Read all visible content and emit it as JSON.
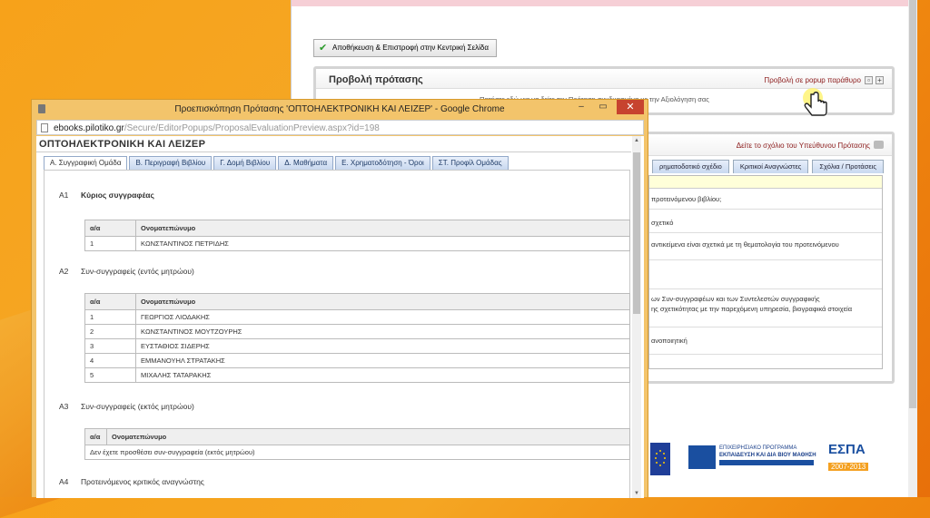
{
  "background_page": {
    "save_button": "Αποθήκευση & Επιστροφή στην Κεντρική Σελίδα",
    "panel_title": "Προβολή πρότασης",
    "popup_link": "Προβολή σε popup παράθυρο",
    "panel_text": "Πατήστε εδώ για να δείτε την Πρόταση συνδυασμένα με την Αξιολόγηση σας",
    "comment_link": "Δείτε το σχόλιο του Υπεύθυνου Πρότασης",
    "tabs": [
      "ρηματοδοτικό σχέδιο",
      "Κριτικοί Αναγνώστες",
      "Σχόλια / Προτάσεις"
    ],
    "rows": [
      "προτεινόμενου βιβλίου;",
      "σχετικό",
      "αντικείμενα είναι σχετικά με τη θεματολογία του προτεινόμενου",
      "ων Συν-συγγραφέων και των Συντελεστών συγγραφικής",
      "ης σχετικότητας με την παρεχόμενη υπηρεσία, βιογραφικά στοιχεία",
      "ανοποιητική"
    ],
    "logos": {
      "program_line1": "ΕΠΙΧΕΙΡΗΣΙΑΚΟ ΠΡΟΓΡΑΜΜΑ",
      "program_line2": "ΕΚΠΑΙΔΕΥΣΗ ΚΑΙ ΔΙΑ ΒΙΟΥ ΜΑΘΗΣΗ",
      "espa": "ΕΣΠΑ",
      "espa_years": "2007-2013"
    }
  },
  "popup": {
    "window_title": "Προεπισκόπηση Πρότασης 'ΟΠΤΟΗΛΕΚΤΡΟΝΙΚΗ ΚΑΙ ΛΕΙΖΕΡ' - Google Chrome",
    "url_host": "ebooks.pilotiko.gr",
    "url_path": "/Secure/EditorPopups/ProposalEvaluationPreview.aspx?id=198",
    "page_title": "ΟΠΤΟΗΛΕΚΤΡΟΝΙΚΗ ΚΑΙ ΛΕΙΖΕΡ",
    "tabs": [
      "Α. Συγγραφική Ομάδα",
      "Β. Περιγραφή Βιβλίου",
      "Γ. Δομή Βιβλίου",
      "Δ. Μαθήματα",
      "Ε. Χρηματοδότηση - Όροι",
      "ΣΤ. Προφίλ Ομάδας"
    ],
    "active_tab": 0,
    "sections": {
      "a1": {
        "num": "Α1",
        "title": "Κύριος συγγραφέας"
      },
      "a2": {
        "num": "Α2",
        "title": "Συν-συγγραφείς (εντός μητρώου)"
      },
      "a3": {
        "num": "Α3",
        "title": "Συν-συγγραφείς (εκτός μητρώου)"
      },
      "a4": {
        "num": "Α4",
        "title": "Προτεινόμενος κριτικός αναγνώστης"
      }
    },
    "col_aa": "α/α",
    "col_name": "Ονοματεπώνυμο",
    "main_author": [
      {
        "n": "1",
        "name": "ΚΩΝΣΤΑΝΤΙΝΟΣ ΠΕΤΡΙΔΗΣ"
      }
    ],
    "coauthors_in": [
      {
        "n": "1",
        "name": "ΓΕΩΡΓΙΟΣ ΛΙΟΔΑΚΗΣ"
      },
      {
        "n": "2",
        "name": "ΚΩΝΣΤΑΝΤΙΝΟΣ ΜΟΥΤΖΟΥΡΗΣ"
      },
      {
        "n": "3",
        "name": "ΕΥΣΤΑΘΙΟΣ ΣΙΔΕΡΗΣ"
      },
      {
        "n": "4",
        "name": "ΕΜΜΑΝΟΥΗΛ ΣΤΡΑΤΑΚΗΣ"
      },
      {
        "n": "5",
        "name": "ΜΙΧΑΛΗΣ ΤΑΤΑΡΑΚΗΣ"
      }
    ],
    "coauthors_out_empty": "Δεν έχετε προσθέσει συν-συγγραφεία (εκτός μητρώου)"
  }
}
